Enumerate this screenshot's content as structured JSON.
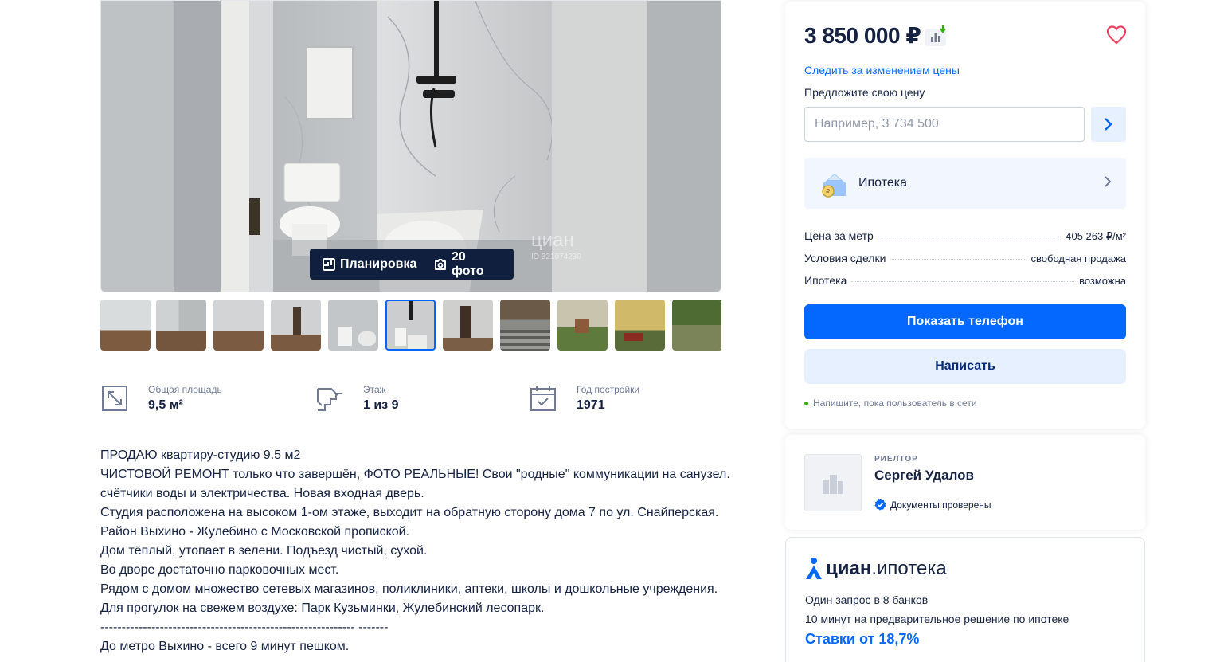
{
  "gallery": {
    "watermark": "циан",
    "watermark_id": "ID 321074230",
    "plan_label": "Планировка",
    "photos_label": "20 фото",
    "thumbnail_count": 11,
    "active_thumbnail_index": 5
  },
  "facts": [
    {
      "label": "Общая площадь",
      "value": "9,5 м²",
      "icon": "area-icon"
    },
    {
      "label": "Этаж",
      "value": "1 из 9",
      "icon": "stairs-icon"
    },
    {
      "label": "Год постройки",
      "value": "1971",
      "icon": "calendar-icon"
    }
  ],
  "description": "ПРОДАЮ квартиру-студию 9.5 м2\nЧИСТОВОЙ РЕМОНТ только что завершён, ФОТО РЕАЛЬНЫЕ! Свои \"родные\" коммуникации на санузел. счётчики воды и электричества. Новая входная дверь.\nСтудия расположена на высоком 1-ом этаже, выходит на обратную сторону дома 7 по ул. Снайперская.\nРайон Выхино - Жулебино с Московской пропиской.\nДом тёплый, утопает в зелени. Подъезд чистый, сухой.\nВо дворе достаточно парковочных мест.\nРядом с домом множество сетевых магазинов, поликлиники, аптеки, школы и дошкольные учреждения.\nДля прогулок на свежем воздухе: Парк Кузьминки, Жулебинский лесопарк.\n------------------------------------------------------------ -------\nДо метро Выхино - всего 9 минут пешком.",
  "price_card": {
    "price": "3 850 000 ₽",
    "price_trend": "down",
    "watch_link": "Следить за изменением цены",
    "offer_label": "Предложите свою цену",
    "offer_placeholder": "Например, 3 734 500",
    "mortgage_label": "Ипотека",
    "rows": [
      {
        "label": "Цена за метр",
        "value": "405 263 ₽/м²"
      },
      {
        "label": "Условия сделки",
        "value": "свободная продажа"
      },
      {
        "label": "Ипотека",
        "value": "возможна"
      }
    ],
    "phone_button": "Показать телефон",
    "write_button": "Написать",
    "online_text": "Напишите, пока пользователь в сети",
    "colors": {
      "primary": "#0468ff",
      "secondary_bg": "#e6f0ff",
      "online": "#34ac0a",
      "text": "#152242"
    }
  },
  "agent": {
    "role": "РИЕЛТОР",
    "name": "Сергей Удалов",
    "docs_text": "Документы проверены"
  },
  "ipoteka": {
    "logo_bold": "циан",
    "logo_light": ".ипотека",
    "line1": "Один запрос в 8 банков",
    "line2": "10 минут на предварительное решение по ипотеке",
    "rates": "Ставки от 18,7%"
  }
}
